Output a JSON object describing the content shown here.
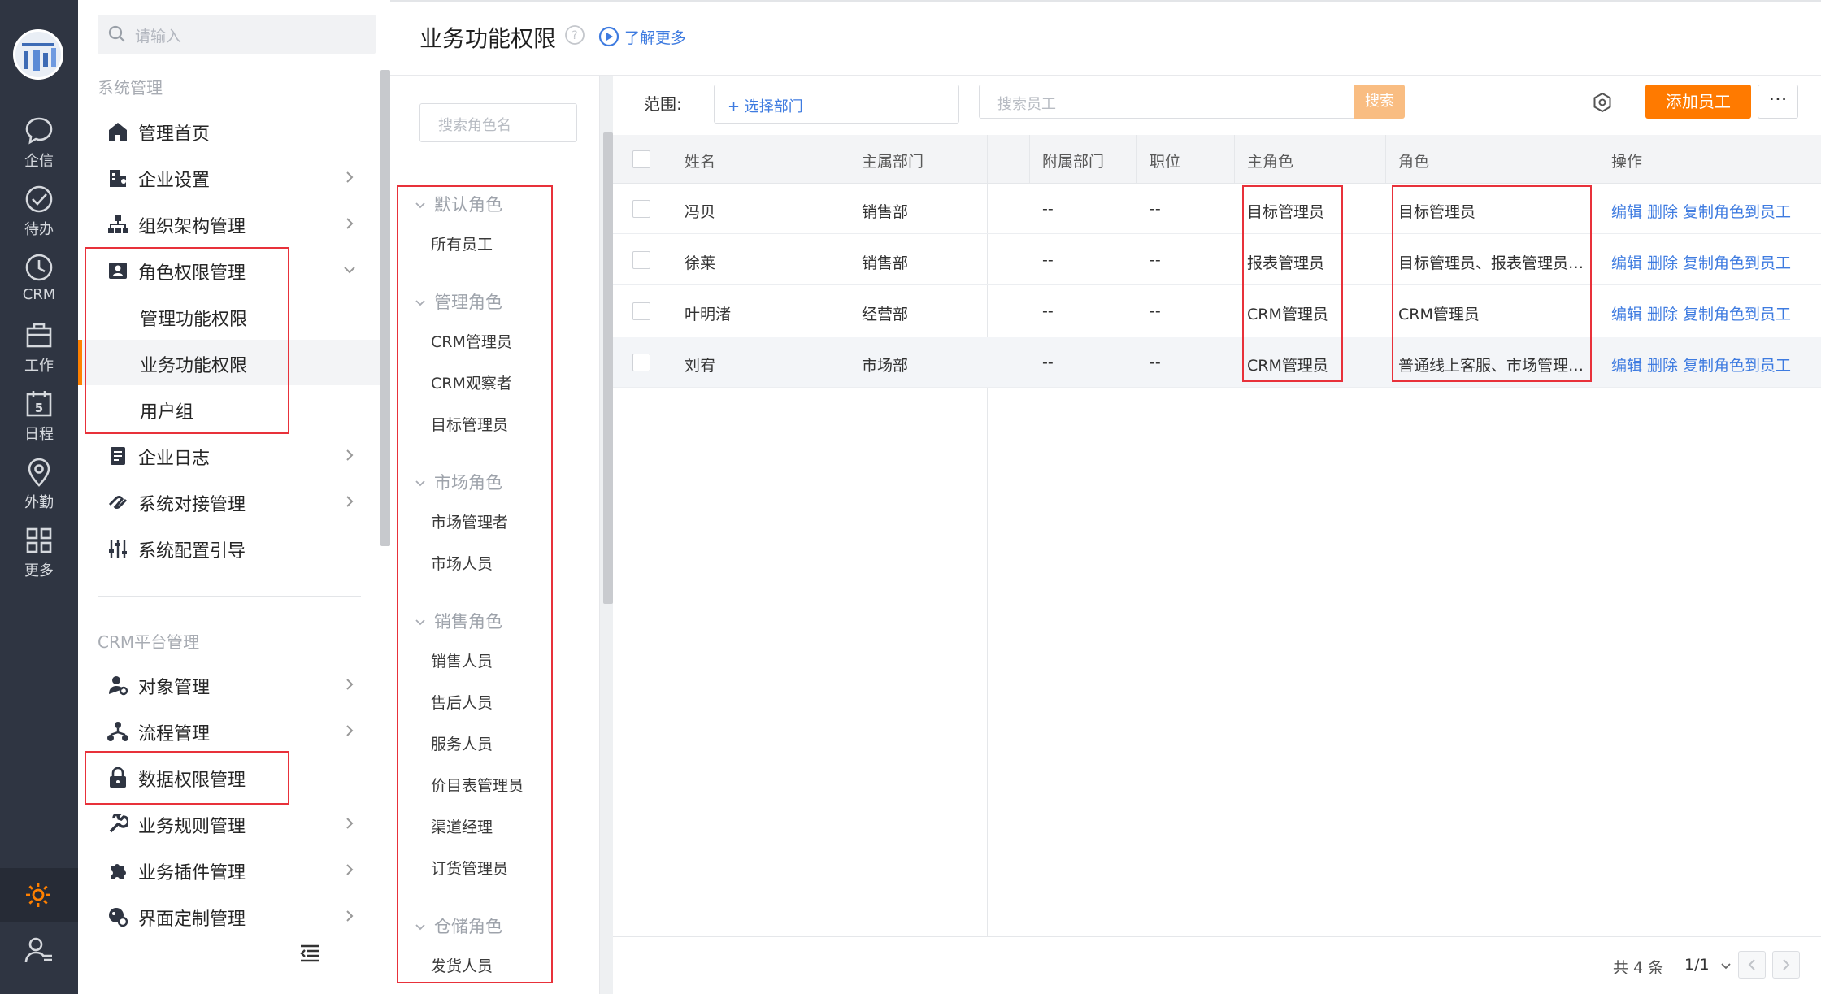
{
  "rail": {
    "items": [
      {
        "label": "企信",
        "icon": "chat-icon"
      },
      {
        "label": "待办",
        "icon": "check-circle-icon"
      },
      {
        "label": "CRM",
        "icon": "clock-icon"
      },
      {
        "label": "工作",
        "icon": "briefcase-icon"
      },
      {
        "label": "日程",
        "icon": "calendar-icon",
        "badge": "5"
      },
      {
        "label": "外勤",
        "icon": "location-pin-icon"
      },
      {
        "label": "更多",
        "icon": "grid-icon"
      }
    ],
    "accent": "#ff8000"
  },
  "nav": {
    "search_placeholder": "请输入",
    "section1_title": "系统管理",
    "section2_title": "CRM平台管理",
    "items1": [
      {
        "label": "管理首页",
        "icon": "home-icon"
      },
      {
        "label": "企业设置",
        "icon": "building-icon"
      },
      {
        "label": "组织架构管理",
        "icon": "org-chart-icon"
      },
      {
        "label": "角色权限管理",
        "icon": "id-card-icon"
      },
      {
        "label": "管理功能权限"
      },
      {
        "label": "业务功能权限"
      },
      {
        "label": "用户组"
      },
      {
        "label": "企业日志",
        "icon": "document-icon"
      },
      {
        "label": "系统对接管理",
        "icon": "link-icon"
      },
      {
        "label": "系统配置引导",
        "icon": "sliders-icon"
      }
    ],
    "items2": [
      {
        "label": "对象管理",
        "icon": "user-settings-icon"
      },
      {
        "label": "流程管理",
        "icon": "flow-icon"
      },
      {
        "label": "数据权限管理",
        "icon": "lock-icon"
      },
      {
        "label": "业务规则管理",
        "icon": "wrench-icon"
      },
      {
        "label": "业务插件管理",
        "icon": "puzzle-icon"
      },
      {
        "label": "界面定制管理",
        "icon": "palette-icon"
      }
    ]
  },
  "header": {
    "title": "业务功能权限",
    "learn_more": "了解更多"
  },
  "roles": {
    "search_placeholder": "搜索角色名",
    "groups": [
      {
        "name": "默认角色",
        "items": [
          "所有员工"
        ]
      },
      {
        "name": "管理角色",
        "items": [
          "CRM管理员",
          "CRM观察者",
          "目标管理员"
        ]
      },
      {
        "name": "市场角色",
        "items": [
          "市场管理者",
          "市场人员"
        ]
      },
      {
        "name": "销售角色",
        "items": [
          "销售人员",
          "售后人员",
          "服务人员",
          "价目表管理员",
          "渠道经理",
          "订货管理员"
        ]
      },
      {
        "name": "仓储角色",
        "items": [
          "发货人员"
        ]
      }
    ]
  },
  "toolbar": {
    "scope_label": "范围:",
    "dept_select": "+ 选择部门",
    "emp_search_placeholder": "搜索员工",
    "search_button": "搜索",
    "add_employee": "添加员工",
    "more": "···"
  },
  "table": {
    "columns": [
      "姓名",
      "主属部门",
      "附属部门",
      "职位",
      "主角色",
      "角色",
      "操作"
    ],
    "rows": [
      {
        "name": "冯贝",
        "dept": "销售部",
        "sub_dept": "--",
        "position": "--",
        "main_role": "目标管理员",
        "roles": "目标管理员"
      },
      {
        "name": "徐莱",
        "dept": "销售部",
        "sub_dept": "--",
        "position": "--",
        "main_role": "报表管理员",
        "roles": "目标管理员、报表管理员、CRM管理员"
      },
      {
        "name": "叶明渚",
        "dept": "经营部",
        "sub_dept": "--",
        "position": "--",
        "main_role": "CRM管理员",
        "roles": "CRM管理员"
      },
      {
        "name": "刘宥",
        "dept": "市场部",
        "sub_dept": "--",
        "position": "--",
        "main_role": "CRM管理员",
        "roles": "普通线上客服、市场管理者、CRM管理员"
      }
    ],
    "actions": [
      "编辑",
      "删除",
      "复制角色到员工"
    ]
  },
  "pagination": {
    "total": "共 4 条",
    "page": "1/1"
  },
  "colors": {
    "brand_orange": "#ff7a00",
    "link_blue": "#3e7be0",
    "annotation_red": "#e8313a",
    "rail_bg": "#2f3542"
  }
}
